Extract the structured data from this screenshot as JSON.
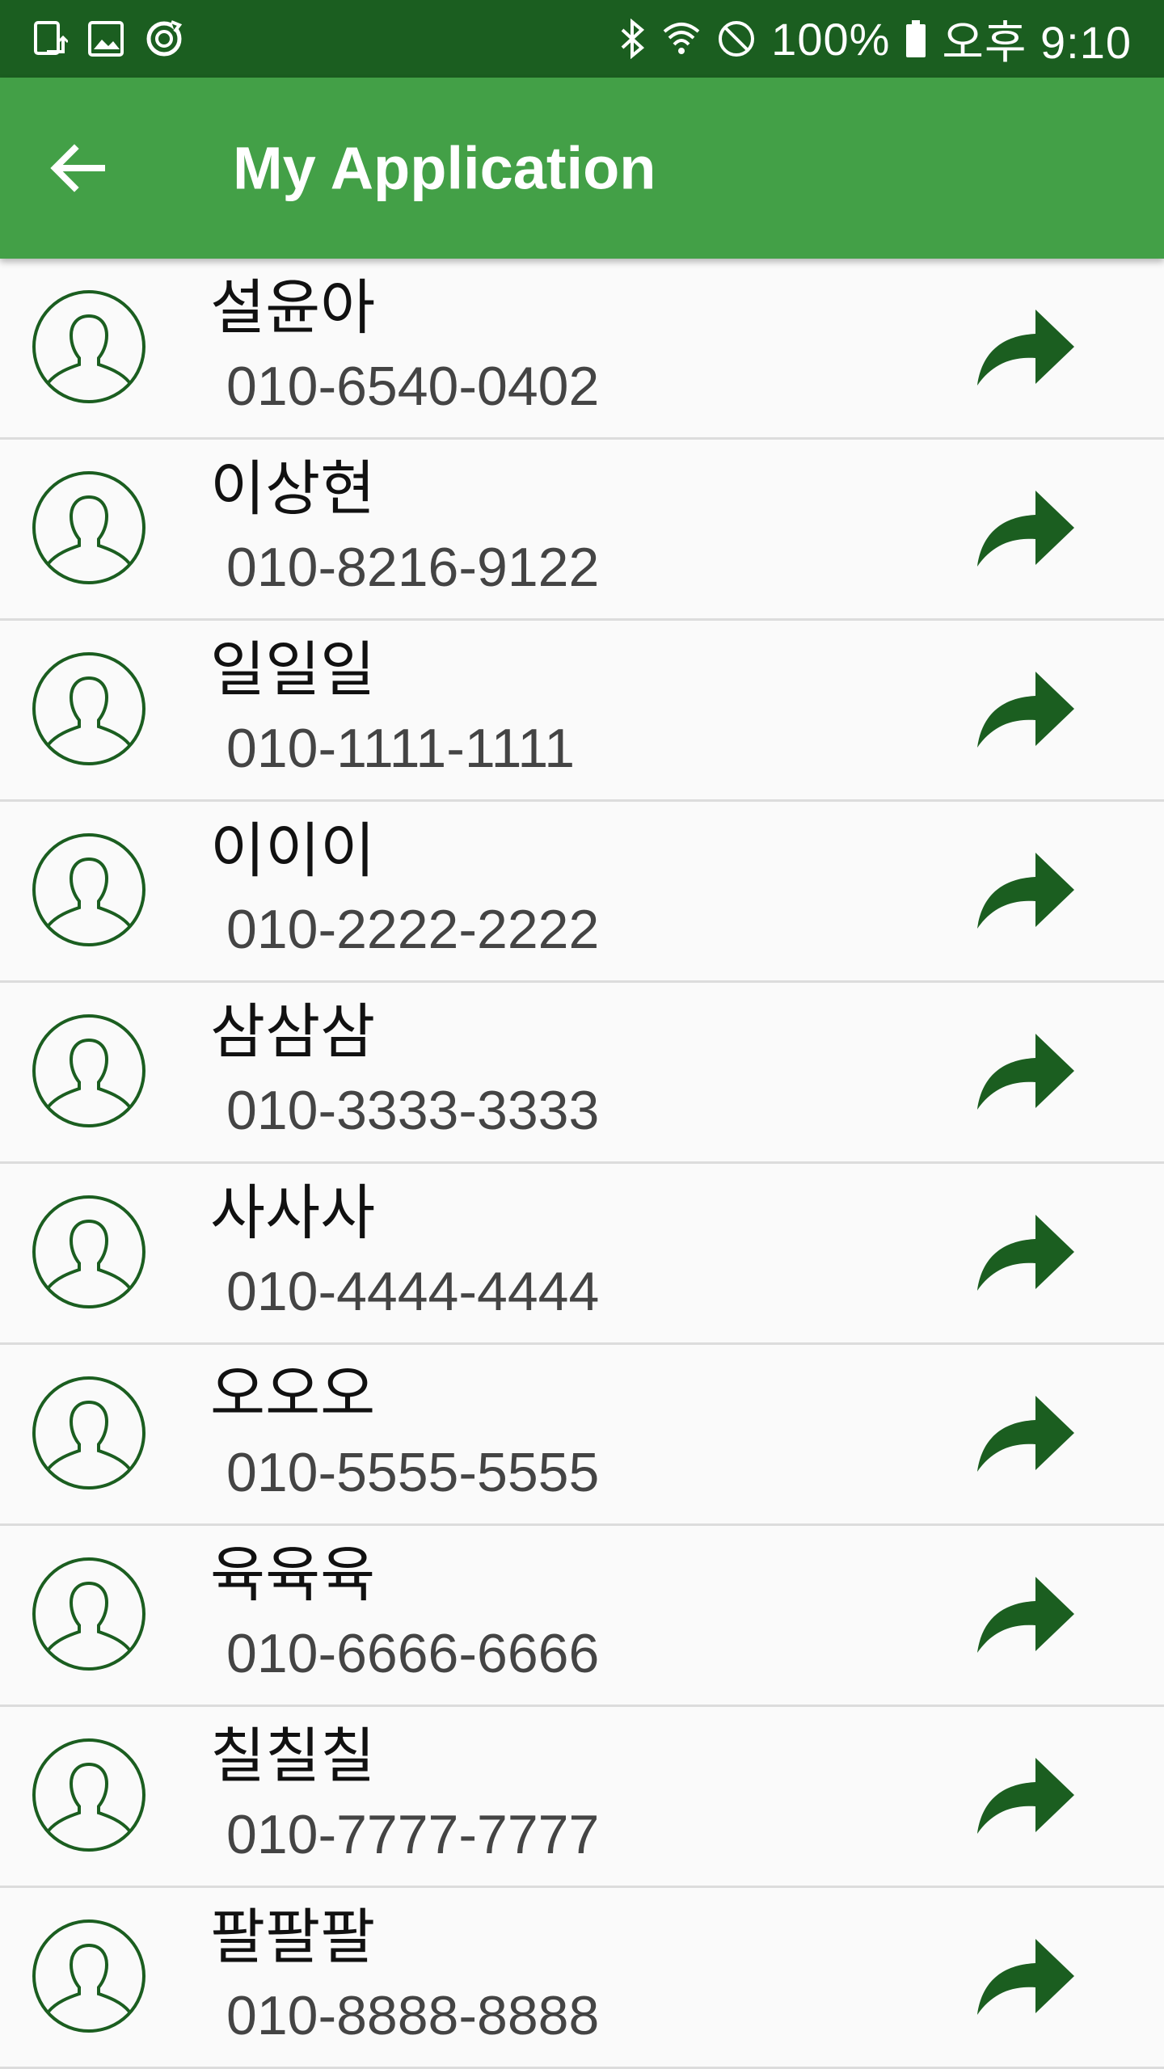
{
  "status_bar": {
    "battery": "100%",
    "time": "오후 9:10",
    "left_icons": [
      "screen-rotate-icon",
      "image-icon",
      "sync-icon"
    ],
    "right_icons": [
      "bluetooth-icon",
      "wifi-icon",
      "do-not-disturb-icon",
      "battery-icon"
    ]
  },
  "app_bar": {
    "title": "My Application",
    "back_icon": "arrow-back-icon",
    "background": "#43a047",
    "status_background": "#1b5e20"
  },
  "contacts": [
    {
      "name": "설윤아",
      "phone": "010-6540-0402"
    },
    {
      "name": "이상현",
      "phone": "010-8216-9122"
    },
    {
      "name": "일일일",
      "phone": "010-1111-1111"
    },
    {
      "name": "이이이",
      "phone": "010-2222-2222"
    },
    {
      "name": "삼삼삼",
      "phone": "010-3333-3333"
    },
    {
      "name": "사사사",
      "phone": "010-4444-4444"
    },
    {
      "name": "오오오",
      "phone": "010-5555-5555"
    },
    {
      "name": "육육육",
      "phone": "010-6666-6666"
    },
    {
      "name": "칠칠칠",
      "phone": "010-7777-7777"
    },
    {
      "name": "팔팔팔",
      "phone": "010-8888-8888"
    }
  ],
  "row_icons": {
    "avatar": "person-outline-icon",
    "action": "forward-arrow-icon",
    "accent": "#1b5e20"
  }
}
